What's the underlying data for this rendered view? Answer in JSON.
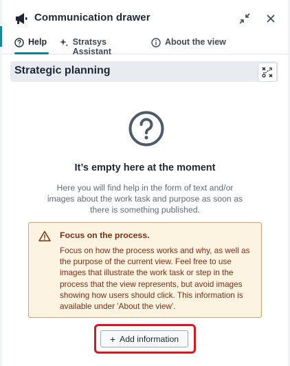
{
  "header": {
    "title": "Communication drawer",
    "icons": [
      "megaphone-icon",
      "collapse-icon",
      "close-icon"
    ]
  },
  "tabs": [
    {
      "label": "Help",
      "icon": "question-circle-icon",
      "active": true
    },
    {
      "label": "Stratsys Assistant",
      "icon": "sparkle-icon",
      "active": false
    },
    {
      "label": "About the view",
      "icon": "info-circle-icon",
      "active": false
    }
  ],
  "section": {
    "title": "Strategic planning",
    "button_icon": "strategy-icon"
  },
  "empty_state": {
    "icon": "question-circle-icon",
    "title": "It’s empty here at the moment",
    "description": "Here you will find help in the form of text and/or images about the work task and purpose as soon as there is something published."
  },
  "warning": {
    "icon": "warning-triangle-icon",
    "title": "Focus on the process.",
    "body": "Focus on how the process works and why, as well as the purpose of the current view. Feel free to use images that illustrate the work task or step in the process that the view represents, but avoid images showing how users should click. This information is available under 'About the view'."
  },
  "actions": {
    "add_label": "Add information",
    "add_icon": "plus-icon"
  },
  "colors": {
    "accent": "#0f7f93",
    "warning_bg": "#fdf3e1",
    "warning_border": "#c8a56a",
    "warning_text": "#7a2e14",
    "highlight": "#e01320"
  }
}
